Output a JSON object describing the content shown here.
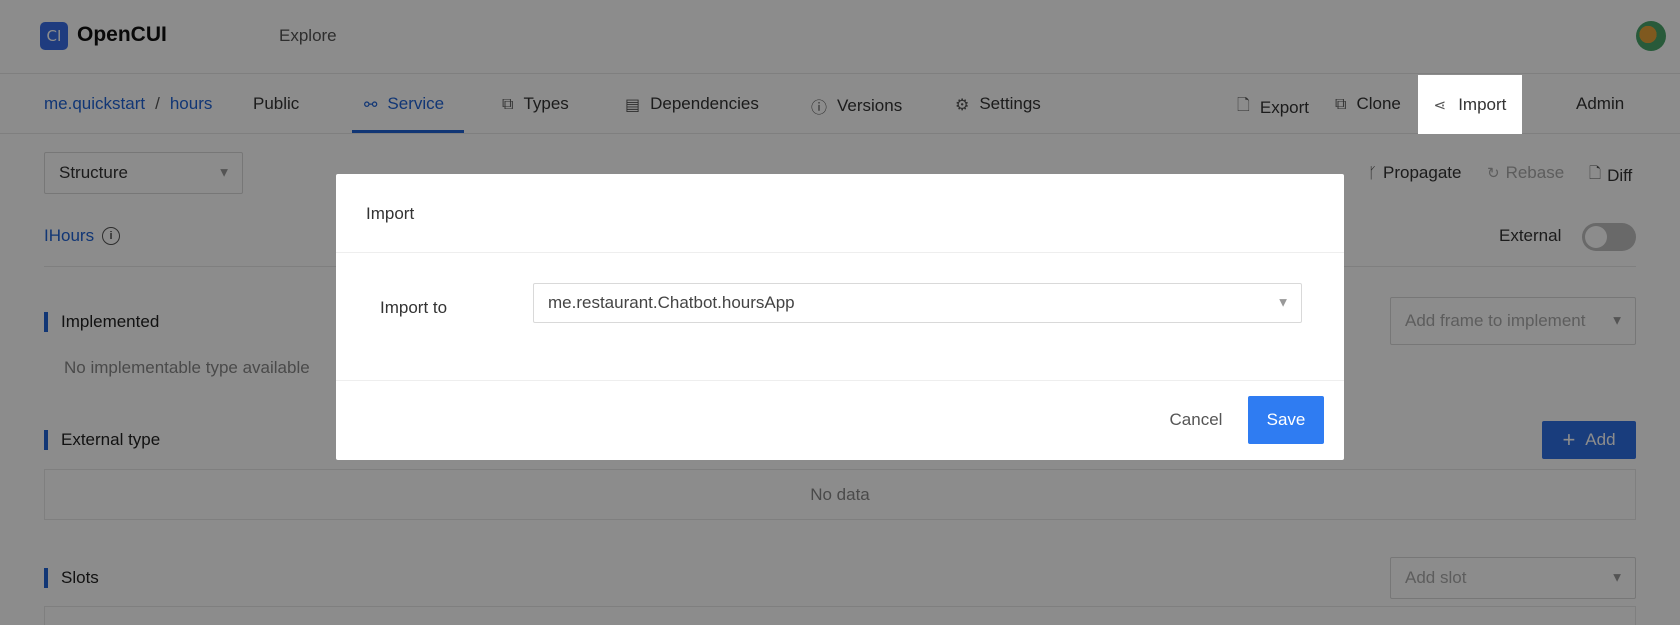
{
  "header": {
    "logo_glyph": "CI",
    "app_name": "OpenCUI",
    "explore": "Explore"
  },
  "nav": {
    "org": "me.quickstart",
    "separator": "/",
    "project": "hours",
    "visibility": "Public",
    "tabs": [
      {
        "label": "Service",
        "icon": "service-icon",
        "active": true
      },
      {
        "label": "Types",
        "icon": "types-icon"
      },
      {
        "label": "Dependencies",
        "icon": "dependencies-icon"
      },
      {
        "label": "Versions",
        "icon": "info-icon"
      },
      {
        "label": "Settings",
        "icon": "gear-icon"
      }
    ],
    "actions": {
      "export": "Export",
      "clone": "Clone",
      "import": "Import",
      "admin": "Admin"
    }
  },
  "toolbar": {
    "structure_select": "Structure",
    "propagate": "Propagate",
    "rebase": "Rebase",
    "diff": "Diff"
  },
  "service": {
    "name": "IHours",
    "external_label": "External",
    "external_on": false
  },
  "sections": {
    "implemented": {
      "title": "Implemented",
      "empty": "No implementable type available",
      "select_placeholder": "Add frame to implement"
    },
    "external_type": {
      "title": "External type",
      "add_label": "Add",
      "empty": "No data"
    },
    "slots": {
      "title": "Slots",
      "select_placeholder": "Add slot"
    }
  },
  "modal": {
    "title": "Import",
    "field_label": "Import to",
    "field_value": "me.restaurant.Chatbot.hoursApp",
    "cancel": "Cancel",
    "save": "Save"
  },
  "colors": {
    "accent": "#1f63d6",
    "primary_button": "#2f7cf2",
    "overlay": "rgba(0,0,0,0.45)"
  }
}
